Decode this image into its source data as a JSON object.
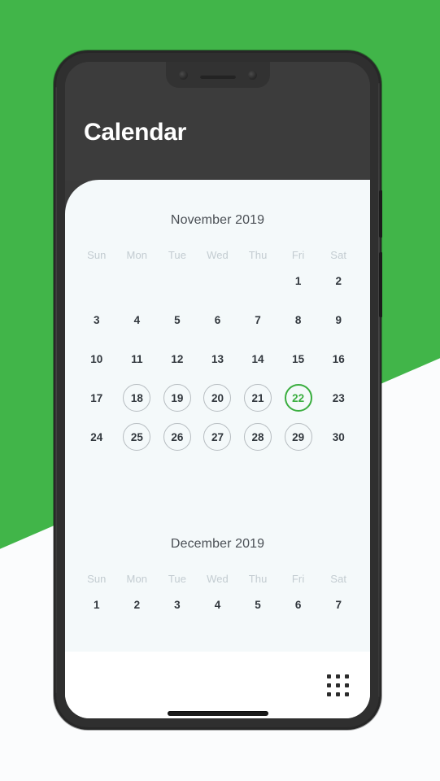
{
  "background": {
    "base_color": "#fbfcfd",
    "accent_color": "#41b549"
  },
  "device": {
    "frame_color": "#272727",
    "screen_color": "#3a3a3a",
    "notch": {
      "camera_left": "camera-dot-left",
      "camera_right": "camera-dot-right",
      "speaker": "earpiece-speaker"
    },
    "buttons": {
      "power": "power-button",
      "volume": "volume-button"
    },
    "bottom_speaker": "bottom-speaker-grille"
  },
  "header": {
    "title": "Calendar",
    "background_color": "#3c3c3c",
    "text_color": "#ffffff"
  },
  "calendar": {
    "today_color": "#3aae3f",
    "ring_color": "#b6bcc0",
    "months": [
      {
        "title": "November 2019",
        "dow": [
          "Sun",
          "Mon",
          "Tue",
          "Wed",
          "Thu",
          "Fri",
          "Sat"
        ],
        "weeks": [
          [
            {
              "label": "",
              "state": "empty"
            },
            {
              "label": "",
              "state": "empty"
            },
            {
              "label": "",
              "state": "empty"
            },
            {
              "label": "",
              "state": "empty"
            },
            {
              "label": "",
              "state": "empty"
            },
            {
              "label": "1",
              "state": "plain"
            },
            {
              "label": "2",
              "state": "plain"
            }
          ],
          [
            {
              "label": "3",
              "state": "plain"
            },
            {
              "label": "4",
              "state": "plain"
            },
            {
              "label": "5",
              "state": "plain"
            },
            {
              "label": "6",
              "state": "plain"
            },
            {
              "label": "7",
              "state": "plain"
            },
            {
              "label": "8",
              "state": "plain"
            },
            {
              "label": "9",
              "state": "plain"
            }
          ],
          [
            {
              "label": "10",
              "state": "plain"
            },
            {
              "label": "11",
              "state": "plain"
            },
            {
              "label": "12",
              "state": "plain"
            },
            {
              "label": "13",
              "state": "plain"
            },
            {
              "label": "14",
              "state": "plain"
            },
            {
              "label": "15",
              "state": "plain"
            },
            {
              "label": "16",
              "state": "plain"
            }
          ],
          [
            {
              "label": "17",
              "state": "plain"
            },
            {
              "label": "18",
              "state": "ringed"
            },
            {
              "label": "19",
              "state": "ringed"
            },
            {
              "label": "20",
              "state": "ringed"
            },
            {
              "label": "21",
              "state": "ringed"
            },
            {
              "label": "22",
              "state": "today"
            },
            {
              "label": "23",
              "state": "plain"
            }
          ],
          [
            {
              "label": "24",
              "state": "plain"
            },
            {
              "label": "25",
              "state": "ringed"
            },
            {
              "label": "26",
              "state": "ringed"
            },
            {
              "label": "27",
              "state": "ringed"
            },
            {
              "label": "28",
              "state": "ringed"
            },
            {
              "label": "29",
              "state": "ringed"
            },
            {
              "label": "30",
              "state": "plain"
            }
          ]
        ]
      },
      {
        "title": "December 2019",
        "dow": [
          "Sun",
          "Mon",
          "Tue",
          "Wed",
          "Thu",
          "Fri",
          "Sat"
        ],
        "weeks": [
          [
            {
              "label": "1",
              "state": "plain"
            },
            {
              "label": "2",
              "state": "plain"
            },
            {
              "label": "3",
              "state": "plain"
            },
            {
              "label": "4",
              "state": "plain"
            },
            {
              "label": "5",
              "state": "plain"
            },
            {
              "label": "6",
              "state": "plain"
            },
            {
              "label": "7",
              "state": "plain"
            }
          ]
        ]
      }
    ]
  },
  "bottom_bar": {
    "grid_icon": "apps-grid-icon",
    "background_color": "#ffffff"
  }
}
